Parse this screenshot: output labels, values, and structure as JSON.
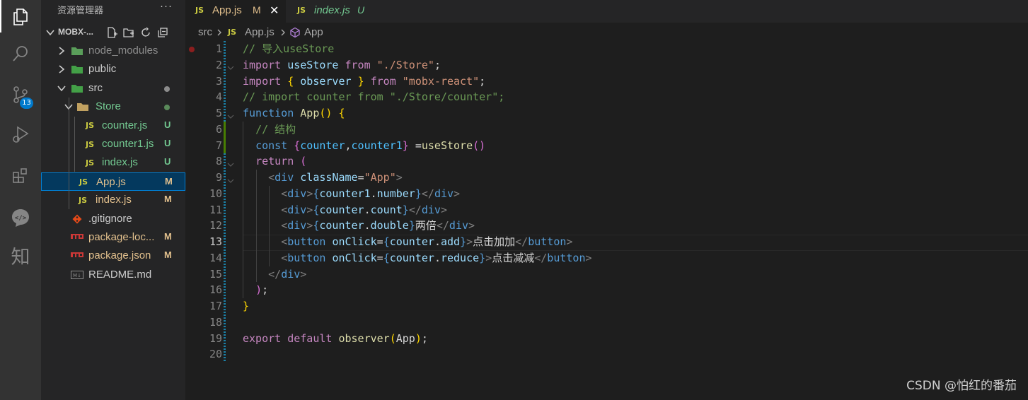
{
  "explorer": {
    "title": "资源管理器",
    "more": "···",
    "project": "MOBX-...",
    "tree": [
      {
        "label": "node_modules",
        "type": "folder",
        "expanded": false,
        "level": 0,
        "color": "#8c8c8c",
        "icon_color": "#5a9e5a"
      },
      {
        "label": "public",
        "type": "folder",
        "expanded": false,
        "level": 0,
        "color": "#cccccc",
        "icon_color": "#43a047"
      },
      {
        "label": "src",
        "type": "folder",
        "expanded": true,
        "level": 0,
        "color": "#cccccc",
        "icon_color": "#43a047",
        "dot": "#8c8c8c"
      },
      {
        "label": "Store",
        "type": "folder",
        "expanded": true,
        "level": 1,
        "color": "#73c991",
        "icon_color": "#c0a060",
        "dot": "#5a8a5a"
      },
      {
        "label": "counter.js",
        "type": "js",
        "level": 2,
        "color": "#73c991",
        "badge": "U",
        "badge_color": "#73c991"
      },
      {
        "label": "counter1.js",
        "type": "js",
        "level": 2,
        "color": "#73c991",
        "badge": "U",
        "badge_color": "#73c991"
      },
      {
        "label": "index.js",
        "type": "js",
        "level": 2,
        "color": "#73c991",
        "badge": "U",
        "badge_color": "#73c991"
      },
      {
        "label": "App.js",
        "type": "js",
        "level": 1,
        "color": "#e2c08d",
        "badge": "M",
        "badge_color": "#e2c08d",
        "selected": true
      },
      {
        "label": "index.js",
        "type": "js",
        "level": 1,
        "color": "#e2c08d",
        "badge": "M",
        "badge_color": "#e2c08d"
      },
      {
        "label": ".gitignore",
        "type": "git",
        "level": 0,
        "color": "#cccccc"
      },
      {
        "label": "package-loc...",
        "type": "npm",
        "level": 0,
        "color": "#e2c08d",
        "badge": "M",
        "badge_color": "#e2c08d"
      },
      {
        "label": "package.json",
        "type": "npm",
        "level": 0,
        "color": "#e2c08d",
        "badge": "M",
        "badge_color": "#e2c08d"
      },
      {
        "label": "README.md",
        "type": "md",
        "level": 0,
        "color": "#cccccc"
      }
    ]
  },
  "activity": {
    "scm_badge": "13",
    "zhi_label": "知"
  },
  "tabs": [
    {
      "icon": "JS",
      "name": "App.js",
      "status": "M",
      "status_color": "#e2c08d",
      "close": "✕",
      "active": true,
      "italic": false
    },
    {
      "icon": "JS",
      "name": "index.js",
      "status": "U",
      "status_color": "#73c991",
      "active": false,
      "italic": true
    }
  ],
  "breadcrumb": {
    "folder": "src",
    "file_icon": "JS",
    "file": "App.js",
    "symbol": "App"
  },
  "editor": {
    "current_line": 13,
    "lines": [
      [
        [
          "c-cm",
          "// 导入useStore"
        ]
      ],
      [
        [
          "c-kw",
          "import"
        ],
        [
          "c-pu",
          " "
        ],
        [
          "c-vr",
          "useStore"
        ],
        [
          "c-pu",
          " "
        ],
        [
          "c-kw",
          "from"
        ],
        [
          "c-pu",
          " "
        ],
        [
          "c-st",
          "\"./Store\""
        ],
        [
          "c-pu",
          ";"
        ]
      ],
      [
        [
          "c-kw",
          "import"
        ],
        [
          "c-pu",
          " "
        ],
        [
          "c-b1",
          "{"
        ],
        [
          "c-pu",
          " "
        ],
        [
          "c-vr",
          "observer"
        ],
        [
          "c-pu",
          " "
        ],
        [
          "c-b1",
          "}"
        ],
        [
          "c-pu",
          " "
        ],
        [
          "c-kw",
          "from"
        ],
        [
          "c-pu",
          " "
        ],
        [
          "c-st",
          "\"mobx-react\""
        ],
        [
          "c-pu",
          ";"
        ]
      ],
      [
        [
          "c-cm",
          "// import counter from \"./Store/counter\";"
        ]
      ],
      [
        [
          "c-bl",
          "function"
        ],
        [
          "c-pu",
          " "
        ],
        [
          "c-fn",
          "App"
        ],
        [
          "c-b1",
          "()"
        ],
        [
          "c-pu",
          " "
        ],
        [
          "c-b1",
          "{"
        ]
      ],
      [
        [
          "c-pu",
          "  "
        ],
        [
          "c-cm",
          "// 结构"
        ]
      ],
      [
        [
          "c-pu",
          "  "
        ],
        [
          "c-bl",
          "const"
        ],
        [
          "c-pu",
          " "
        ],
        [
          "c-b2",
          "{"
        ],
        [
          "c-cn",
          "counter"
        ],
        [
          "c-pu",
          ","
        ],
        [
          "c-cn",
          "counter1"
        ],
        [
          "c-b2",
          "}"
        ],
        [
          "c-pu",
          " ="
        ],
        [
          "c-fn",
          "useStore"
        ],
        [
          "c-b2",
          "()"
        ]
      ],
      [
        [
          "c-pu",
          "  "
        ],
        [
          "c-kw",
          "return"
        ],
        [
          "c-pu",
          " "
        ],
        [
          "c-b2",
          "("
        ]
      ],
      [
        [
          "c-pu",
          "    "
        ],
        [
          "c-tg",
          "<"
        ],
        [
          "c-bl",
          "div"
        ],
        [
          "c-pu",
          " "
        ],
        [
          "c-vr",
          "className"
        ],
        [
          "c-pu",
          "="
        ],
        [
          "c-st",
          "\"App\""
        ],
        [
          "c-tg",
          ">"
        ]
      ],
      [
        [
          "c-pu",
          "      "
        ],
        [
          "c-tg",
          "<"
        ],
        [
          "c-bl",
          "div"
        ],
        [
          "c-tg",
          ">"
        ],
        [
          "c-bl",
          "{"
        ],
        [
          "c-vr",
          "counter1"
        ],
        [
          "c-pu",
          "."
        ],
        [
          "c-vr",
          "number"
        ],
        [
          "c-bl",
          "}"
        ],
        [
          "c-tg",
          "</"
        ],
        [
          "c-bl",
          "div"
        ],
        [
          "c-tg",
          ">"
        ]
      ],
      [
        [
          "c-pu",
          "      "
        ],
        [
          "c-tg",
          "<"
        ],
        [
          "c-bl",
          "div"
        ],
        [
          "c-tg",
          ">"
        ],
        [
          "c-bl",
          "{"
        ],
        [
          "c-vr",
          "counter"
        ],
        [
          "c-pu",
          "."
        ],
        [
          "c-vr",
          "count"
        ],
        [
          "c-bl",
          "}"
        ],
        [
          "c-tg",
          "</"
        ],
        [
          "c-bl",
          "div"
        ],
        [
          "c-tg",
          ">"
        ]
      ],
      [
        [
          "c-pu",
          "      "
        ],
        [
          "c-tg",
          "<"
        ],
        [
          "c-bl",
          "div"
        ],
        [
          "c-tg",
          ">"
        ],
        [
          "c-bl",
          "{"
        ],
        [
          "c-vr",
          "counter"
        ],
        [
          "c-pu",
          "."
        ],
        [
          "c-vr",
          "double"
        ],
        [
          "c-bl",
          "}"
        ],
        [
          "c-pu",
          "两倍"
        ],
        [
          "c-tg",
          "</"
        ],
        [
          "c-bl",
          "div"
        ],
        [
          "c-tg",
          ">"
        ]
      ],
      [
        [
          "c-pu",
          "      "
        ],
        [
          "c-tg",
          "<"
        ],
        [
          "c-bl",
          "button"
        ],
        [
          "c-pu",
          " "
        ],
        [
          "c-vr",
          "onClick"
        ],
        [
          "c-pu",
          "="
        ],
        [
          "c-bl",
          "{"
        ],
        [
          "c-vr",
          "counter"
        ],
        [
          "c-pu",
          "."
        ],
        [
          "c-vr",
          "add"
        ],
        [
          "c-bl",
          "}"
        ],
        [
          "c-tg",
          ">"
        ],
        [
          "c-pu",
          "点击加加"
        ],
        [
          "c-tg",
          "</"
        ],
        [
          "c-bl",
          "button"
        ],
        [
          "c-tg",
          ">"
        ]
      ],
      [
        [
          "c-pu",
          "      "
        ],
        [
          "c-tg",
          "<"
        ],
        [
          "c-bl",
          "button"
        ],
        [
          "c-pu",
          " "
        ],
        [
          "c-vr",
          "onClick"
        ],
        [
          "c-pu",
          "="
        ],
        [
          "c-bl",
          "{"
        ],
        [
          "c-vr",
          "counter"
        ],
        [
          "c-pu",
          "."
        ],
        [
          "c-vr",
          "reduce"
        ],
        [
          "c-bl",
          "}"
        ],
        [
          "c-tg",
          ">"
        ],
        [
          "c-pu",
          "点击减减"
        ],
        [
          "c-tg",
          "</"
        ],
        [
          "c-bl",
          "button"
        ],
        [
          "c-tg",
          ">"
        ]
      ],
      [
        [
          "c-pu",
          "    "
        ],
        [
          "c-tg",
          "</"
        ],
        [
          "c-bl",
          "div"
        ],
        [
          "c-tg",
          ">"
        ]
      ],
      [
        [
          "c-pu",
          "  "
        ],
        [
          "c-b2",
          ")"
        ],
        [
          "c-pu",
          ";"
        ]
      ],
      [
        [
          "c-b1",
          "}"
        ]
      ],
      [],
      [
        [
          "c-kw",
          "export"
        ],
        [
          "c-pu",
          " "
        ],
        [
          "c-kw",
          "default"
        ],
        [
          "c-pu",
          " "
        ],
        [
          "c-fn",
          "observer"
        ],
        [
          "c-b1",
          "("
        ],
        [
          "c-pu",
          "App"
        ],
        [
          "c-b1",
          ")"
        ],
        [
          "c-pu",
          ";"
        ]
      ],
      []
    ]
  },
  "watermark": "CSDN @怕红的番茄"
}
